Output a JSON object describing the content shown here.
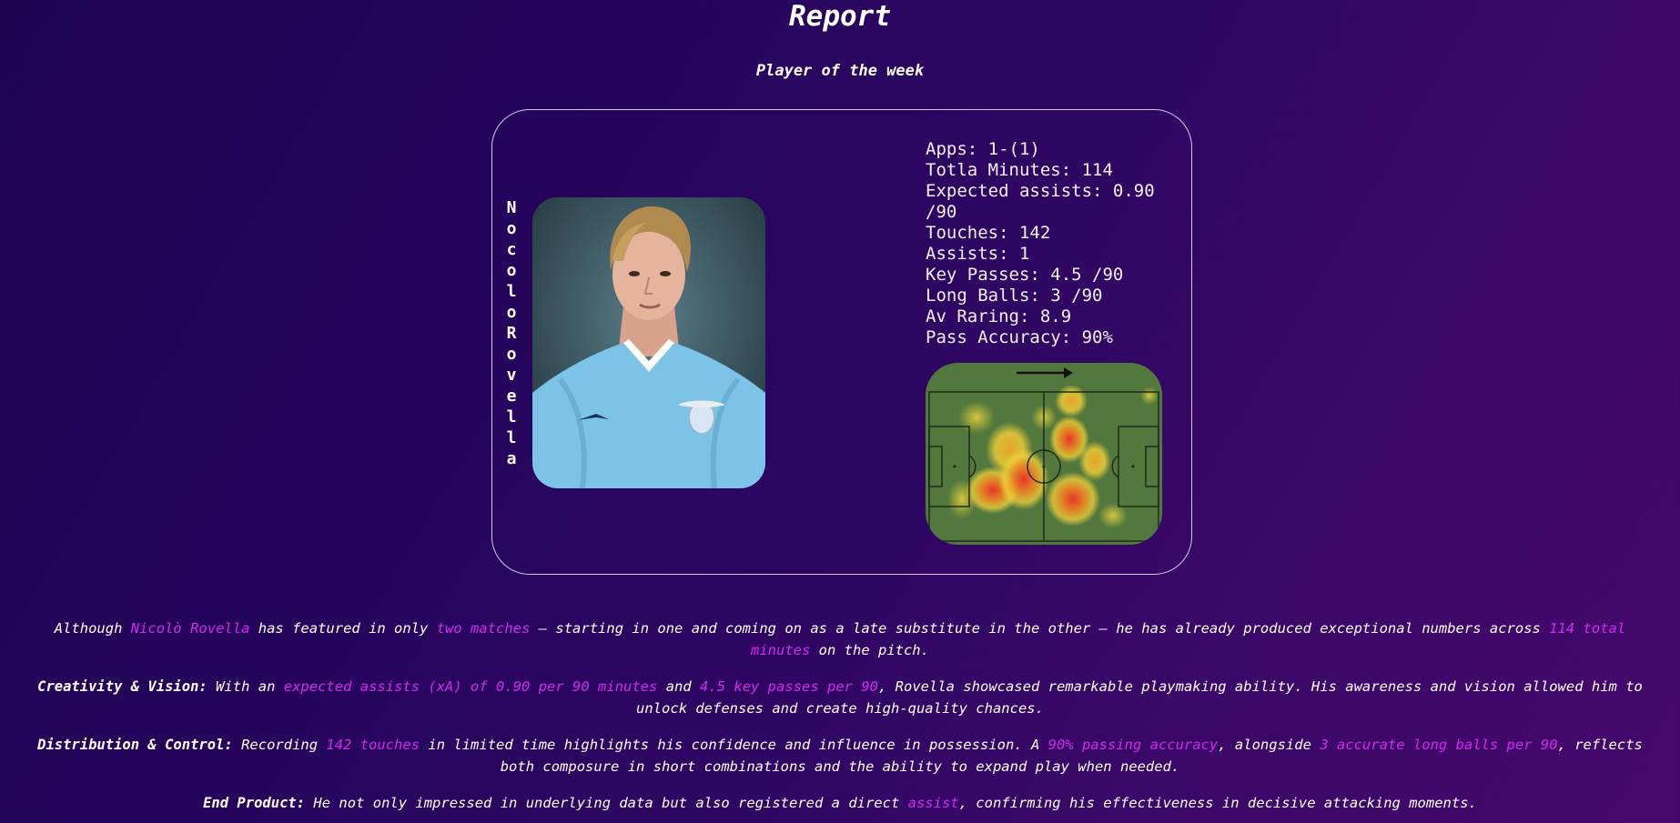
{
  "header": {
    "title": "Report",
    "subtitle": "Player of the week"
  },
  "player": {
    "vertical_name": "Nocolo Rovella"
  },
  "stats": [
    "Apps: 1-(1)",
    "Totla Minutes: 114",
    "Expected assists: 0.90 /90",
    "Touches: 142",
    "Assists: 1",
    "Key Passes: 4.5 /90",
    "Long Balls: 3 /90",
    "Av Raring: 8.9",
    "Pass Accuracy: 90%"
  ],
  "report": {
    "p1": {
      "t1": "Although ",
      "h1": "Nicolò Rovella",
      "t2": " has featured in only ",
      "h2": "two matches",
      "t3": " — starting in one and coming on as a late substitute in the other — he has already produced exceptional numbers across ",
      "h3": "114 total minutes",
      "t4": " on the pitch."
    },
    "p2": {
      "lead": "Creativity & Vision:",
      "t1": " With an ",
      "h1": "expected assists (xA) of 0.90 per 90 minutes",
      "t2": " and ",
      "h2": "4.5 key passes per 90",
      "t3": ", Rovella showcased remarkable playmaking ability. His awareness and vision allowed him to unlock defenses and create high-quality chances."
    },
    "p3": {
      "lead": "Distribution & Control:",
      "t1": " Recording ",
      "h1": "142 touches",
      "t2": " in limited time highlights his confidence and influence in possession. A ",
      "h2": "90% passing accuracy",
      "t3": ", alongside ",
      "h3": "3 accurate long balls per 90",
      "t4": ", reflects both composure in short combinations and the ability to expand play when needed."
    },
    "p4": {
      "lead": "End Product:",
      "t1": " He not only impressed in underlying data but also registered a direct ",
      "h1": "assist",
      "t2": ", confirming his effectiveness in decisive attacking moments."
    }
  }
}
